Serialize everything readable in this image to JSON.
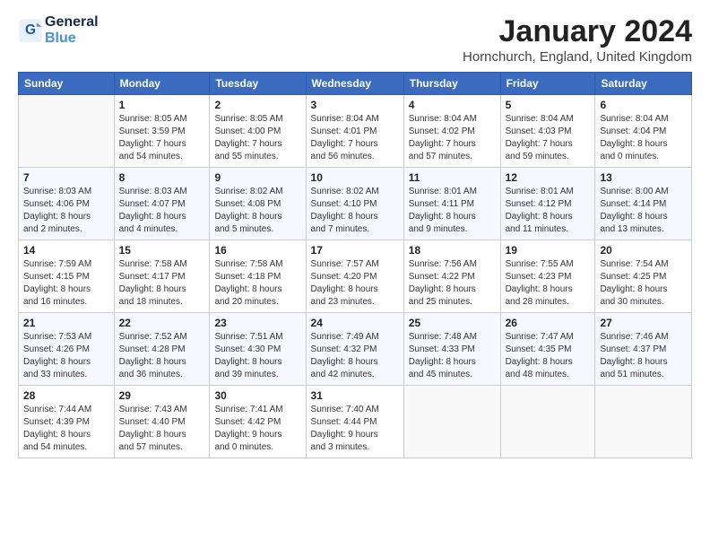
{
  "logo": {
    "line1": "General",
    "line2": "Blue"
  },
  "title": "January 2024",
  "subtitle": "Hornchurch, England, United Kingdom",
  "days_header": [
    "Sunday",
    "Monday",
    "Tuesday",
    "Wednesday",
    "Thursday",
    "Friday",
    "Saturday"
  ],
  "weeks": [
    [
      {
        "day": "",
        "info": ""
      },
      {
        "day": "1",
        "info": "Sunrise: 8:05 AM\nSunset: 3:59 PM\nDaylight: 7 hours\nand 54 minutes."
      },
      {
        "day": "2",
        "info": "Sunrise: 8:05 AM\nSunset: 4:00 PM\nDaylight: 7 hours\nand 55 minutes."
      },
      {
        "day": "3",
        "info": "Sunrise: 8:04 AM\nSunset: 4:01 PM\nDaylight: 7 hours\nand 56 minutes."
      },
      {
        "day": "4",
        "info": "Sunrise: 8:04 AM\nSunset: 4:02 PM\nDaylight: 7 hours\nand 57 minutes."
      },
      {
        "day": "5",
        "info": "Sunrise: 8:04 AM\nSunset: 4:03 PM\nDaylight: 7 hours\nand 59 minutes."
      },
      {
        "day": "6",
        "info": "Sunrise: 8:04 AM\nSunset: 4:04 PM\nDaylight: 8 hours\nand 0 minutes."
      }
    ],
    [
      {
        "day": "7",
        "info": "Sunrise: 8:03 AM\nSunset: 4:06 PM\nDaylight: 8 hours\nand 2 minutes."
      },
      {
        "day": "8",
        "info": "Sunrise: 8:03 AM\nSunset: 4:07 PM\nDaylight: 8 hours\nand 4 minutes."
      },
      {
        "day": "9",
        "info": "Sunrise: 8:02 AM\nSunset: 4:08 PM\nDaylight: 8 hours\nand 5 minutes."
      },
      {
        "day": "10",
        "info": "Sunrise: 8:02 AM\nSunset: 4:10 PM\nDaylight: 8 hours\nand 7 minutes."
      },
      {
        "day": "11",
        "info": "Sunrise: 8:01 AM\nSunset: 4:11 PM\nDaylight: 8 hours\nand 9 minutes."
      },
      {
        "day": "12",
        "info": "Sunrise: 8:01 AM\nSunset: 4:12 PM\nDaylight: 8 hours\nand 11 minutes."
      },
      {
        "day": "13",
        "info": "Sunrise: 8:00 AM\nSunset: 4:14 PM\nDaylight: 8 hours\nand 13 minutes."
      }
    ],
    [
      {
        "day": "14",
        "info": "Sunrise: 7:59 AM\nSunset: 4:15 PM\nDaylight: 8 hours\nand 16 minutes."
      },
      {
        "day": "15",
        "info": "Sunrise: 7:58 AM\nSunset: 4:17 PM\nDaylight: 8 hours\nand 18 minutes."
      },
      {
        "day": "16",
        "info": "Sunrise: 7:58 AM\nSunset: 4:18 PM\nDaylight: 8 hours\nand 20 minutes."
      },
      {
        "day": "17",
        "info": "Sunrise: 7:57 AM\nSunset: 4:20 PM\nDaylight: 8 hours\nand 23 minutes."
      },
      {
        "day": "18",
        "info": "Sunrise: 7:56 AM\nSunset: 4:22 PM\nDaylight: 8 hours\nand 25 minutes."
      },
      {
        "day": "19",
        "info": "Sunrise: 7:55 AM\nSunset: 4:23 PM\nDaylight: 8 hours\nand 28 minutes."
      },
      {
        "day": "20",
        "info": "Sunrise: 7:54 AM\nSunset: 4:25 PM\nDaylight: 8 hours\nand 30 minutes."
      }
    ],
    [
      {
        "day": "21",
        "info": "Sunrise: 7:53 AM\nSunset: 4:26 PM\nDaylight: 8 hours\nand 33 minutes."
      },
      {
        "day": "22",
        "info": "Sunrise: 7:52 AM\nSunset: 4:28 PM\nDaylight: 8 hours\nand 36 minutes."
      },
      {
        "day": "23",
        "info": "Sunrise: 7:51 AM\nSunset: 4:30 PM\nDaylight: 8 hours\nand 39 minutes."
      },
      {
        "day": "24",
        "info": "Sunrise: 7:49 AM\nSunset: 4:32 PM\nDaylight: 8 hours\nand 42 minutes."
      },
      {
        "day": "25",
        "info": "Sunrise: 7:48 AM\nSunset: 4:33 PM\nDaylight: 8 hours\nand 45 minutes."
      },
      {
        "day": "26",
        "info": "Sunrise: 7:47 AM\nSunset: 4:35 PM\nDaylight: 8 hours\nand 48 minutes."
      },
      {
        "day": "27",
        "info": "Sunrise: 7:46 AM\nSunset: 4:37 PM\nDaylight: 8 hours\nand 51 minutes."
      }
    ],
    [
      {
        "day": "28",
        "info": "Sunrise: 7:44 AM\nSunset: 4:39 PM\nDaylight: 8 hours\nand 54 minutes."
      },
      {
        "day": "29",
        "info": "Sunrise: 7:43 AM\nSunset: 4:40 PM\nDaylight: 8 hours\nand 57 minutes."
      },
      {
        "day": "30",
        "info": "Sunrise: 7:41 AM\nSunset: 4:42 PM\nDaylight: 9 hours\nand 0 minutes."
      },
      {
        "day": "31",
        "info": "Sunrise: 7:40 AM\nSunset: 4:44 PM\nDaylight: 9 hours\nand 3 minutes."
      },
      {
        "day": "",
        "info": ""
      },
      {
        "day": "",
        "info": ""
      },
      {
        "day": "",
        "info": ""
      }
    ]
  ]
}
